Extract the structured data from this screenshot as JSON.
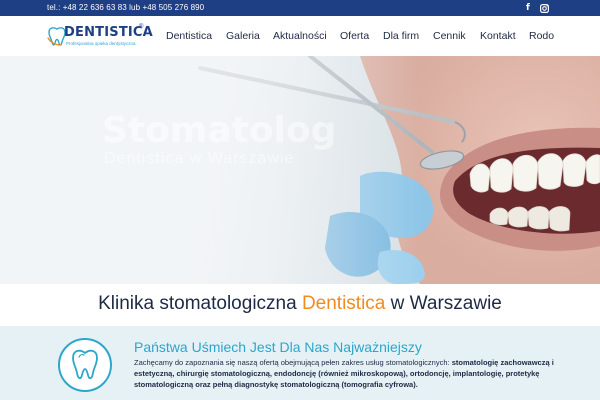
{
  "topbar": {
    "phone": "tel.: +48 22 636 63 83 lub +48 505 276 890",
    "social": [
      {
        "icon": "facebook-icon",
        "glyph": "f"
      },
      {
        "icon": "instagram-icon"
      }
    ]
  },
  "header": {
    "logo": {
      "name": "DENTISTICA",
      "registered": "®",
      "tagline": "Profesjonalna opieka dentystyczna"
    },
    "nav": [
      "Dentistica",
      "Galeria",
      "Aktualności",
      "Oferta",
      "Dla firm",
      "Cennik",
      "Kontakt",
      "Rodo"
    ]
  },
  "hero": {
    "faded_title": "Stomatolog",
    "faded_subtitle": "Dentistica w Warszawie"
  },
  "headline": {
    "prefix": "Klinika stomatologiczna ",
    "brand": "Dentistica",
    "suffix": " w Warszawie"
  },
  "info": {
    "icon": "tooth-icon",
    "title": "Państwa Uśmiech Jest Dla Nas Najważniejszy",
    "body_intro": "Zachęcamy do zapoznania się naszą ofertą obejmującą pełen zakres usług stomatologicznych: ",
    "body_bold": "stomatologię zachowawczą i estetyczną, chirurgię stomatologiczną, endodoncję (również mikroskopową), ortodoncję, implantologię, protetykę stomatologiczną oraz pełną diagnostykę stomatologiczną (tomografia cyfrowa)."
  },
  "colors": {
    "topbar": "#1e3f83",
    "brand_orange": "#f08b1e",
    "accent_teal": "#2ca6c9",
    "info_bg": "#e6f1f6"
  }
}
